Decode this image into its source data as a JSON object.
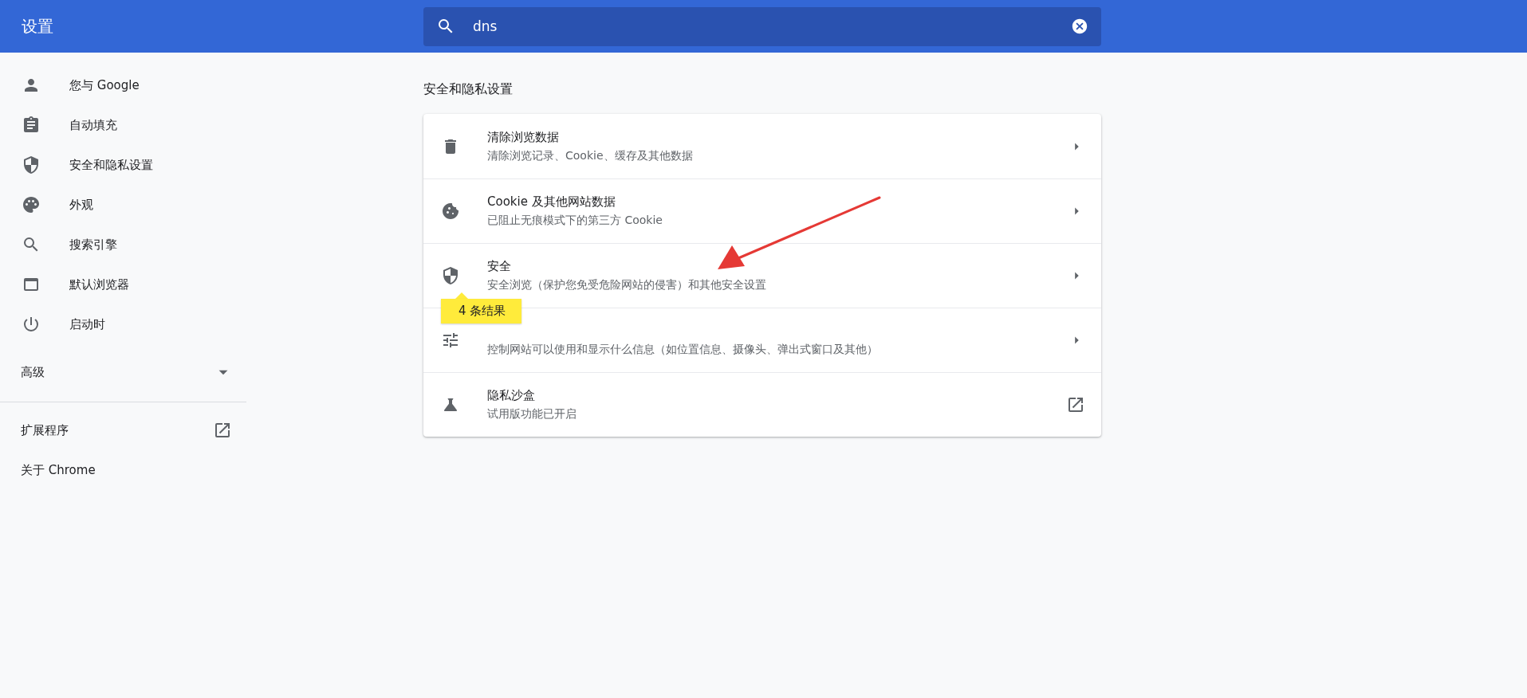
{
  "header": {
    "title": "设置",
    "search": {
      "value": "dns"
    }
  },
  "sidebar": {
    "items": [
      {
        "kind": "person",
        "label": "您与 Google"
      },
      {
        "kind": "clipboard",
        "label": "自动填充"
      },
      {
        "kind": "shield",
        "label": "安全和隐私设置"
      },
      {
        "kind": "palette",
        "label": "外观"
      },
      {
        "kind": "search",
        "label": "搜索引擎"
      },
      {
        "kind": "browser",
        "label": "默认浏览器"
      },
      {
        "kind": "power",
        "label": "启动时"
      }
    ],
    "advanced": {
      "label": "高级",
      "expanded": false
    },
    "links": [
      {
        "label": "扩展程序",
        "external": true
      },
      {
        "label": "关于 Chrome",
        "external": false
      }
    ]
  },
  "section": {
    "title": "安全和隐私设置",
    "rows": [
      {
        "kind": "trash",
        "title": "清除浏览数据",
        "subtitle": "清除浏览记录、Cookie、缓存及其他数据",
        "external": false
      },
      {
        "kind": "cookie",
        "title": "Cookie 及其他网站数据",
        "subtitle": "已阻止无痕模式下的第三方 Cookie",
        "external": false
      },
      {
        "kind": "shield",
        "title": "安全",
        "subtitle": "安全浏览（保护您免受危险网站的侵害）和其他安全设置",
        "external": false
      },
      {
        "kind": "tune",
        "subtitle": "控制网站可以使用和显示什么信息（如位置信息、摄像头、弹出式窗口及其他）",
        "external": false
      },
      {
        "kind": "flask",
        "title": "隐私沙盒",
        "subtitle": "试用版功能已开启",
        "external": true
      }
    ]
  },
  "tooltip": {
    "text": "4 条结果"
  },
  "annotation_arrow": true
}
